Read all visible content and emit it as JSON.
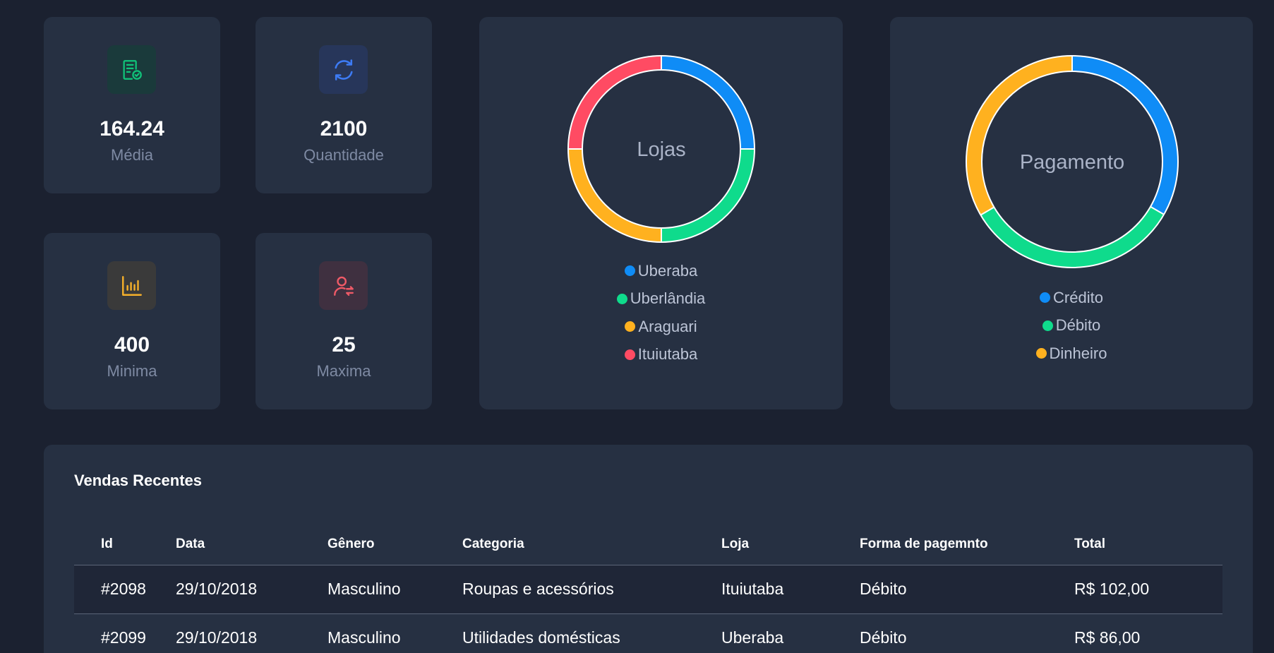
{
  "stats": [
    {
      "value": "164.24",
      "label": "Média",
      "icon": "receipt-check-icon",
      "color": "#10c47a"
    },
    {
      "value": "2100",
      "label": "Quantidade",
      "icon": "refresh-icon",
      "color": "#3d7bf5"
    },
    {
      "value": "400",
      "label": "Minima",
      "icon": "bar-chart-icon",
      "color": "#f6b02a"
    },
    {
      "value": "25",
      "label": "Maxima",
      "icon": "user-switch-icon",
      "color": "#ef5a67"
    }
  ],
  "chart_data": [
    {
      "type": "pie",
      "title": "Lojas",
      "categories": [
        "Uberaba",
        "Uberlândia",
        "Araguari",
        "Ituiutaba"
      ],
      "values": [
        25,
        25,
        25,
        25
      ],
      "colors": [
        "#0f8cf6",
        "#0fdb8c",
        "#ffb11f",
        "#ff4b63"
      ],
      "legend": "bottom"
    },
    {
      "type": "pie",
      "title": "Pagamento",
      "categories": [
        "Crédito",
        "Débito",
        "Dinheiro"
      ],
      "values": [
        33.3,
        33.3,
        33.4
      ],
      "colors": [
        "#0f8cf6",
        "#0fdb8c",
        "#ffb11f"
      ],
      "legend": "bottom"
    }
  ],
  "table": {
    "title": "Vendas Recentes",
    "headers": [
      "Id",
      "Data",
      "Gênero",
      "Categoria",
      "Loja",
      "Forma de pagemnto",
      "Total"
    ],
    "rows": [
      [
        "#2098",
        "29/10/2018",
        "Masculino",
        "Roupas e acessórios",
        "Ituiutaba",
        "Débito",
        "R$ 102,00"
      ],
      [
        "#2099",
        "29/10/2018",
        "Masculino",
        "Utilidades domésticas",
        "Uberaba",
        "Débito",
        "R$ 86,00"
      ]
    ]
  }
}
